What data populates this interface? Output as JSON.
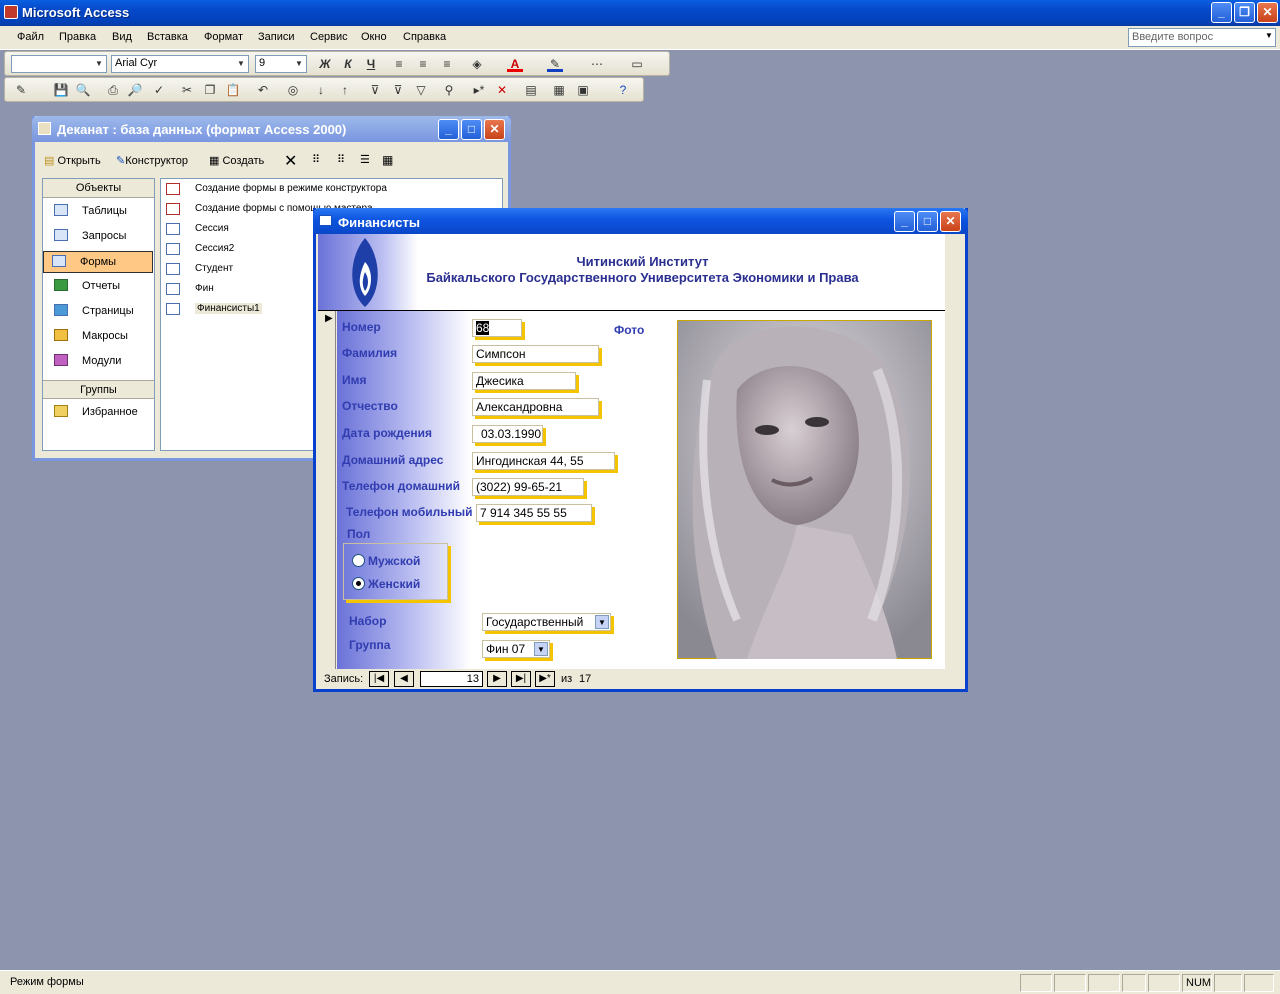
{
  "app": {
    "title": "Microsoft Access"
  },
  "menu": [
    "Файл",
    "Правка",
    "Вид",
    "Вставка",
    "Формат",
    "Записи",
    "Сервис",
    "Окно",
    "Справка"
  ],
  "help_placeholder": "Введите вопрос",
  "format_toolbar": {
    "object_combo": "",
    "font": "Arial Cyr",
    "size": "9"
  },
  "db_window": {
    "title": "Деканат : база данных (формат Access 2000)",
    "toolbar": {
      "open": "Открыть",
      "design": "Конструктор",
      "create": "Создать"
    },
    "objects_header": "Объекты",
    "objects": [
      "Таблицы",
      "Запросы",
      "Формы",
      "Отчеты",
      "Страницы",
      "Макросы",
      "Модули"
    ],
    "selected_object": "Формы",
    "groups_header": "Группы",
    "groups": [
      "Избранное"
    ],
    "list": [
      "Создание формы в режиме конструктора",
      "Создание формы с помощью мастера",
      "Сессия",
      "Сессия2",
      "Студент",
      "Фин",
      "Финансисты1"
    ]
  },
  "form_window": {
    "title": "Финансисты",
    "header_line1": "Читинский Институт",
    "header_line2": "Байкальского Государственного Университета Экономики и Права",
    "photo_label": "Фото",
    "fields": {
      "number": {
        "label": "Номер",
        "value": "68"
      },
      "surname": {
        "label": "Фамилия",
        "value": "Симпсон"
      },
      "name": {
        "label": "Имя",
        "value": "Джесика"
      },
      "patronymic": {
        "label": "Отчество",
        "value": "Александровна"
      },
      "birthdate": {
        "label": "Дата рождения",
        "value": "03.03.1990"
      },
      "address": {
        "label": "Домашний адрес",
        "value": "Ингодинская 44, 55"
      },
      "home_phone": {
        "label": "Телефон домашний",
        "value": "(3022) 99-65-21"
      },
      "mobile": {
        "label": "Телефон мобильный",
        "value": "7 914 345 55 55"
      }
    },
    "gender": {
      "label": "Пол",
      "options": [
        "Мужской",
        "Женский"
      ],
      "selected": "Женский"
    },
    "intake": {
      "label": "Набор",
      "value": "Государственный"
    },
    "group": {
      "label": "Группа",
      "value": "Фин 07"
    },
    "nav": {
      "label": "Запись:",
      "current": "13",
      "of_label": "из",
      "total": "17"
    }
  },
  "status": {
    "mode": "Режим формы",
    "num": "NUM"
  },
  "colors": {
    "title_blue": "#0a47c8",
    "form_label": "#303cb0",
    "field_shadow": "#f5c400",
    "desktop": "#8c95ad"
  }
}
